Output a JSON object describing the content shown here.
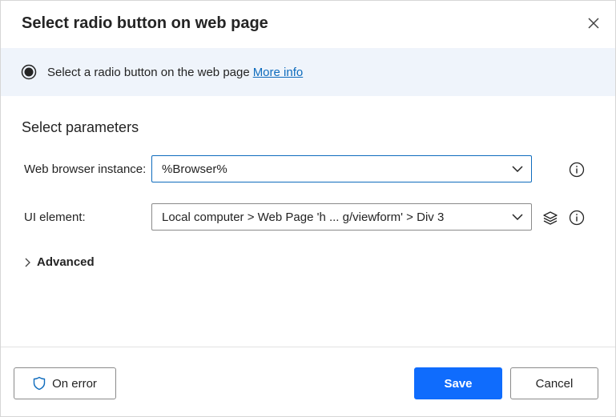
{
  "dialog": {
    "title": "Select radio button on web page"
  },
  "banner": {
    "text": "Select a radio button on the web page",
    "link": "More info"
  },
  "parameters": {
    "section_title": "Select parameters",
    "browser_label": "Web browser instance:",
    "browser_value": "%Browser%",
    "ui_element_label": "UI element:",
    "ui_element_value": "Local computer > Web Page 'h ... g/viewform' > Div 3"
  },
  "advanced": {
    "label": "Advanced"
  },
  "footer": {
    "on_error_label": "On error",
    "save_label": "Save",
    "cancel_label": "Cancel"
  },
  "colors": {
    "accent": "#0f6cfd",
    "banner_bg": "#eff4fb",
    "link": "#0f6cbd"
  },
  "icons": [
    "close-icon",
    "radio-selected-icon",
    "chevron-down-icon",
    "info-icon",
    "layers-icon",
    "chevron-right-icon",
    "shield-icon"
  ]
}
